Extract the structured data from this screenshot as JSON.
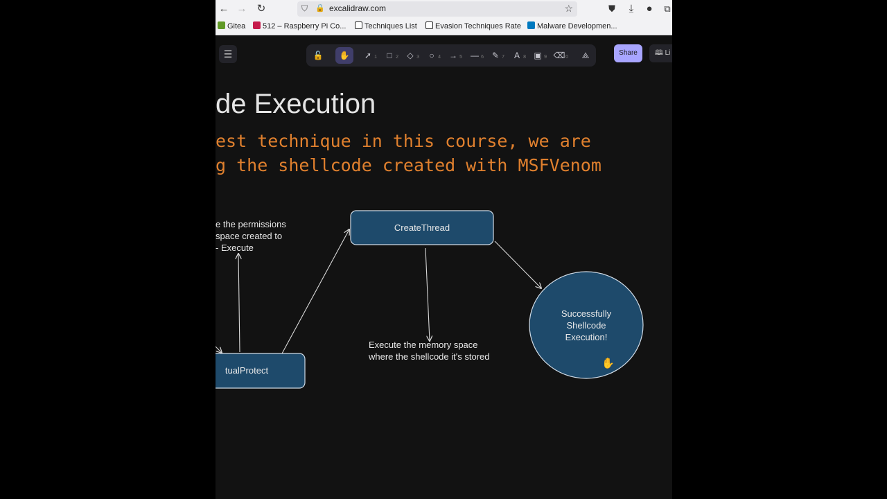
{
  "browser": {
    "url": "excalidraw.com",
    "bookmarks": [
      {
        "label": "Gitea",
        "icon": "gitea-icon",
        "color": "#609926"
      },
      {
        "label": "512 – Raspberry Pi Co...",
        "icon": "raspberry-pi-icon",
        "color": "#c51a4a"
      },
      {
        "label": "Techniques List",
        "icon": "notion-icon",
        "color": "#ffffff"
      },
      {
        "label": "Evasion Techniques Rate",
        "icon": "notion-icon",
        "color": "#ffffff"
      },
      {
        "label": "Malware Developmen...",
        "icon": "trello-icon",
        "color": "#0079bf"
      }
    ]
  },
  "toolbar": {
    "tools": [
      {
        "name": "lock",
        "glyph": "🔓",
        "key": ""
      },
      {
        "name": "hand",
        "glyph": "✋",
        "key": ""
      },
      {
        "name": "selection",
        "glyph": "➚",
        "key": "1"
      },
      {
        "name": "rectangle",
        "glyph": "□",
        "key": "2"
      },
      {
        "name": "diamond",
        "glyph": "◇",
        "key": "3"
      },
      {
        "name": "ellipse",
        "glyph": "○",
        "key": "4"
      },
      {
        "name": "arrow",
        "glyph": "→",
        "key": "5"
      },
      {
        "name": "line",
        "glyph": "—",
        "key": "6"
      },
      {
        "name": "draw",
        "glyph": "✎",
        "key": "7"
      },
      {
        "name": "text",
        "glyph": "A",
        "key": "8"
      },
      {
        "name": "image",
        "glyph": "▣",
        "key": "9"
      },
      {
        "name": "eraser",
        "glyph": "⌫",
        "key": "0"
      },
      {
        "name": "extra-tools",
        "glyph": "⟁",
        "key": ""
      }
    ],
    "active_tool": "hand",
    "share_label": "Share",
    "library_label": "Li"
  },
  "canvas": {
    "title": "de Execution",
    "subtitle_line1": "est technique in this course, we are",
    "subtitle_line2": "g the shellcode created with MSFVenom",
    "note_permissions": [
      "e the permissions",
      "space created to",
      "- Execute"
    ],
    "note_execute": [
      "Execute the memory space",
      "where the shellcode it's stored"
    ],
    "node_virtualprotect": "tualProtect",
    "node_createthread": "CreateThread",
    "node_success": [
      "Successfully",
      "Shellcode",
      "Execution!"
    ]
  },
  "colors": {
    "node_fill": "#1e4a6b",
    "node_stroke": "#d0dbe6",
    "subtitle": "#e0802e",
    "canvas_bg": "#121212"
  }
}
